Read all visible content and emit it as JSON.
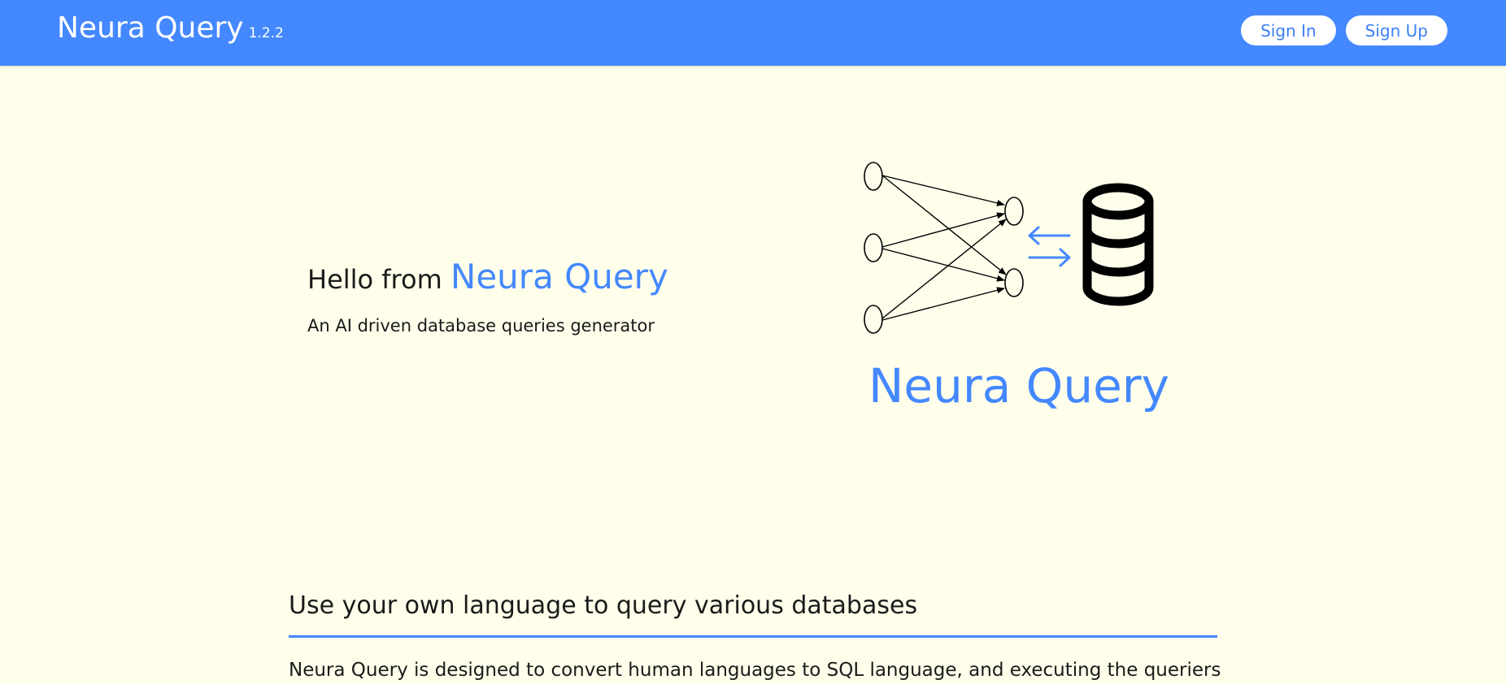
{
  "navbar": {
    "brand": "Neura Query",
    "version": "1.2.2",
    "sign_in": "Sign In",
    "sign_up": "Sign Up"
  },
  "hero": {
    "greeting": "Hello from",
    "brand": "Neura Query",
    "subtitle": "An AI driven database queries generator",
    "logo_text": "Neura Query"
  },
  "section": {
    "title": "Use your own language to query various databases",
    "text": "Neura Query is designed to convert human languages to SQL language, and executing the queriers"
  },
  "colors": {
    "accent": "#4488FF",
    "background": "#FFFEEB"
  },
  "icons": [
    "neural-network-icon",
    "exchange-arrows-icon",
    "database-icon"
  ]
}
